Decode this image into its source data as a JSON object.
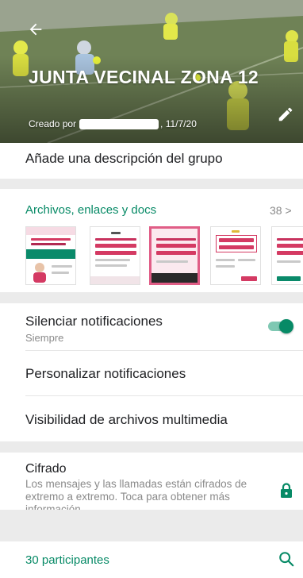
{
  "header": {
    "title": "JUNTA VECINAL ZONA 12",
    "created_prefix": "Creado por",
    "created_date": ", 11/7/20",
    "back_icon": "arrow-left-icon",
    "edit_icon": "pencil-icon"
  },
  "description": {
    "label": "Añade una descripción del grupo"
  },
  "media": {
    "title": "Archivos, enlaces y docs",
    "count": "38 >",
    "thumbnails": [
      {
        "headline": "ADULTOS MAYORES",
        "accent": "#d43a63"
      },
      {
        "headline": "EL COVID-19",
        "accent": "#d43a63"
      },
      {
        "headline": "EL COVID-19",
        "accent": "#d43a63"
      },
      {
        "headline": "CAMPAÑA DE SALUD",
        "accent": "#d43a63"
      },
      {
        "headline": "EL CO",
        "accent": "#d43a63"
      }
    ]
  },
  "notifications": {
    "mute_label": "Silenciar notificaciones",
    "mute_value": "Siempre",
    "mute_on": true,
    "custom_label": "Personalizar notificaciones",
    "media_visibility_label": "Visibilidad de archivos multimedia"
  },
  "encryption": {
    "title": "Cifrado",
    "description": "Los mensajes y las llamadas están cifrados de extremo a extremo. Toca para obtener más información.",
    "icon": "lock-icon"
  },
  "participants": {
    "label": "30 participantes",
    "icon": "search-icon"
  },
  "colors": {
    "accent": "#078a66",
    "divider_gap": "#ebebeb",
    "secondary_text": "#8a8a8a"
  }
}
